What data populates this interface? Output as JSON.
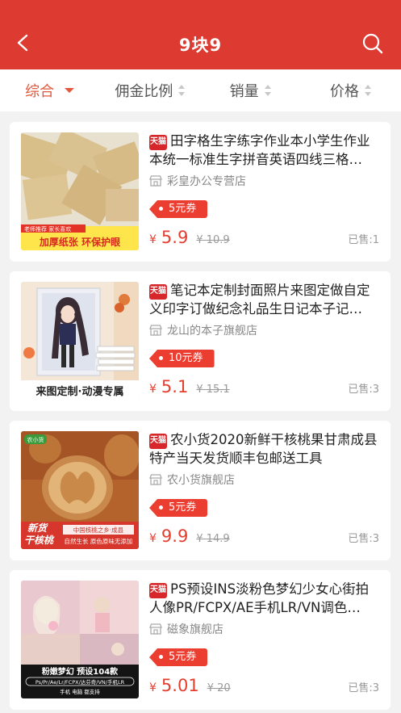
{
  "header": {
    "title": "9块9",
    "back_icon": "back-arrow-icon",
    "search_icon": "search-icon",
    "bg_color": "#dd3b31"
  },
  "sortbar": {
    "items": [
      {
        "label": "综合",
        "active": true
      },
      {
        "label": "佣金比例"
      },
      {
        "label": "销量"
      },
      {
        "label": "价格"
      }
    ],
    "active_color": "#e2583c"
  },
  "products": [
    {
      "badge": "天猫",
      "name": "田字格生字练字作业本小学生作业本统一标准生字拼音英语四线三格…",
      "shop": "彩皇办公专营店",
      "coupon": "5元券",
      "yen": "¥",
      "price": "5.9",
      "original": "10.9",
      "sold": "已售:1",
      "thumb": {
        "tag1": "老师推荐 家长喜欢",
        "tag2": "加厚纸张 环保护眼"
      }
    },
    {
      "badge": "天猫",
      "name": "笔记本定制封面照片来图定做自定义印字订做纪念礼品生日记本子记…",
      "shop": "龙山的本子旗舰店",
      "coupon": "10元券",
      "yen": "¥",
      "price": "5.1",
      "original": "15.1",
      "sold": "已售:3",
      "thumb": {
        "caption": "来图定制·动漫专属"
      }
    },
    {
      "badge": "天猫",
      "name": "农小货2020新鲜干核桃果甘肃成县特产当天发货顺丰包邮送工具",
      "shop": "农小货旗舰店",
      "coupon": "5元券",
      "yen": "¥",
      "price": "9.9",
      "original": "14.9",
      "sold": "已售:3",
      "thumb": {
        "brand": "农小货",
        "big": "新货\n干核桃",
        "line1": "中国核桃之乡·成县",
        "line2": "自然生长 原色原味无添加"
      }
    },
    {
      "badge": "天猫",
      "name": "PS预设INS淡粉色梦幻少女心街拍人像PR/FCPX/AE手机LR/VN调色…",
      "shop": "磁象旗舰店",
      "coupon": "5元券",
      "yen": "¥",
      "price": "5.01",
      "original": "20",
      "sold": "已售:3",
      "thumb": {
        "title": "粉嫩梦幻 预设104款",
        "sub": "Ps/Pr/Ae/Lr/FCPX/达芬奇/VN/手机LR",
        "sub2": "手机 电脑 都支持"
      }
    }
  ]
}
